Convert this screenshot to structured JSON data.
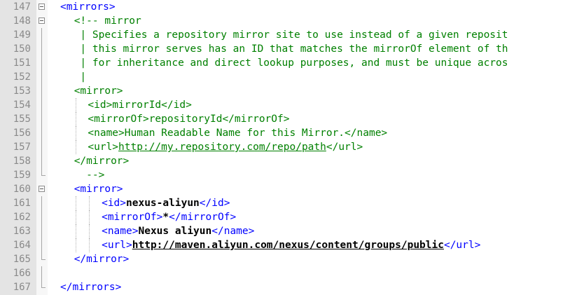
{
  "editor": {
    "lines": [
      {
        "no": "147",
        "fold": "box",
        "indent": 0,
        "parts": [
          {
            "t": "<mirrors>",
            "c": "tag"
          }
        ]
      },
      {
        "no": "148",
        "fold": "box",
        "indent": 1,
        "parts": [
          {
            "t": "<!-- mirror",
            "c": "cm"
          }
        ]
      },
      {
        "no": "149",
        "fold": "line",
        "indent": 1,
        "parts": [
          {
            "t": " | Specifies a repository mirror site to use instead of a given reposit",
            "c": "cm"
          }
        ]
      },
      {
        "no": "150",
        "fold": "line",
        "indent": 1,
        "parts": [
          {
            "t": " | this mirror serves has an ID that matches the mirrorOf element of th",
            "c": "cm"
          }
        ]
      },
      {
        "no": "151",
        "fold": "line",
        "indent": 1,
        "parts": [
          {
            "t": " | for inheritance and direct lookup purposes, and must be unique acros",
            "c": "cm"
          }
        ]
      },
      {
        "no": "152",
        "fold": "line",
        "indent": 1,
        "parts": [
          {
            "t": " |",
            "c": "cm"
          }
        ]
      },
      {
        "no": "153",
        "fold": "line",
        "indent": 1,
        "parts": [
          {
            "t": "<mirror>",
            "c": "cm"
          }
        ]
      },
      {
        "no": "154",
        "fold": "line",
        "indent": 2,
        "parts": [
          {
            "t": "<id>mirrorId</id>",
            "c": "cm"
          }
        ]
      },
      {
        "no": "155",
        "fold": "line",
        "indent": 2,
        "parts": [
          {
            "t": "<mirrorOf>repositoryId</mirrorOf>",
            "c": "cm"
          }
        ]
      },
      {
        "no": "156",
        "fold": "line",
        "indent": 2,
        "parts": [
          {
            "t": "<name>Human Readable Name for this Mirror.</name>",
            "c": "cm"
          }
        ]
      },
      {
        "no": "157",
        "fold": "line",
        "indent": 2,
        "parts": [
          {
            "t": "<url>",
            "c": "cm"
          },
          {
            "t": "http://my.repository.com/repo/path",
            "c": "cm url"
          },
          {
            "t": "</url>",
            "c": "cm"
          }
        ]
      },
      {
        "no": "158",
        "fold": "line",
        "indent": 1,
        "parts": [
          {
            "t": "</mirror>",
            "c": "cm"
          }
        ]
      },
      {
        "no": "159",
        "fold": "tail",
        "indent": 1,
        "parts": [
          {
            "t": "  -->",
            "c": "cm"
          }
        ]
      },
      {
        "no": "160",
        "fold": "box",
        "indent": 1,
        "parts": [
          {
            "t": "<mirror>",
            "c": "tag"
          }
        ]
      },
      {
        "no": "161",
        "fold": "line",
        "indent": 3,
        "parts": [
          {
            "t": "<id>",
            "c": "tag"
          },
          {
            "t": "nexus-aliyun",
            "c": "bold"
          },
          {
            "t": "</id>",
            "c": "tag"
          }
        ]
      },
      {
        "no": "162",
        "fold": "line",
        "indent": 3,
        "parts": [
          {
            "t": "<mirrorOf>",
            "c": "tag"
          },
          {
            "t": "*",
            "c": "bold"
          },
          {
            "t": "</mirrorOf>",
            "c": "tag"
          }
        ]
      },
      {
        "no": "163",
        "fold": "line",
        "indent": 3,
        "parts": [
          {
            "t": "<name>",
            "c": "tag"
          },
          {
            "t": "Nexus aliyun",
            "c": "bold"
          },
          {
            "t": "</name>",
            "c": "tag"
          }
        ]
      },
      {
        "no": "164",
        "fold": "line",
        "indent": 3,
        "parts": [
          {
            "t": "<url>",
            "c": "tag"
          },
          {
            "t": "http://maven.aliyun.com/nexus/content/groups/public",
            "c": "bold url"
          },
          {
            "t": "</url>",
            "c": "tag"
          }
        ]
      },
      {
        "no": "165",
        "fold": "tail",
        "indent": 1,
        "parts": [
          {
            "t": "</mirror>",
            "c": "tag"
          }
        ]
      },
      {
        "no": "166",
        "fold": "line",
        "indent": 0,
        "parts": [
          {
            "t": "",
            "c": "txt"
          }
        ]
      },
      {
        "no": "167",
        "fold": "tail",
        "indent": 0,
        "parts": [
          {
            "t": "</mirrors>",
            "c": "tag"
          }
        ]
      }
    ]
  },
  "colors": {
    "tag": "#0000ff",
    "comment": "#008000",
    "line_number": "#8a8a8a",
    "gutter_bg": "#e4e4e4"
  },
  "icons": {
    "fold_open": "minus-box-icon",
    "fold_line": "fold-guide-line",
    "fold_end": "fold-end-corner"
  }
}
